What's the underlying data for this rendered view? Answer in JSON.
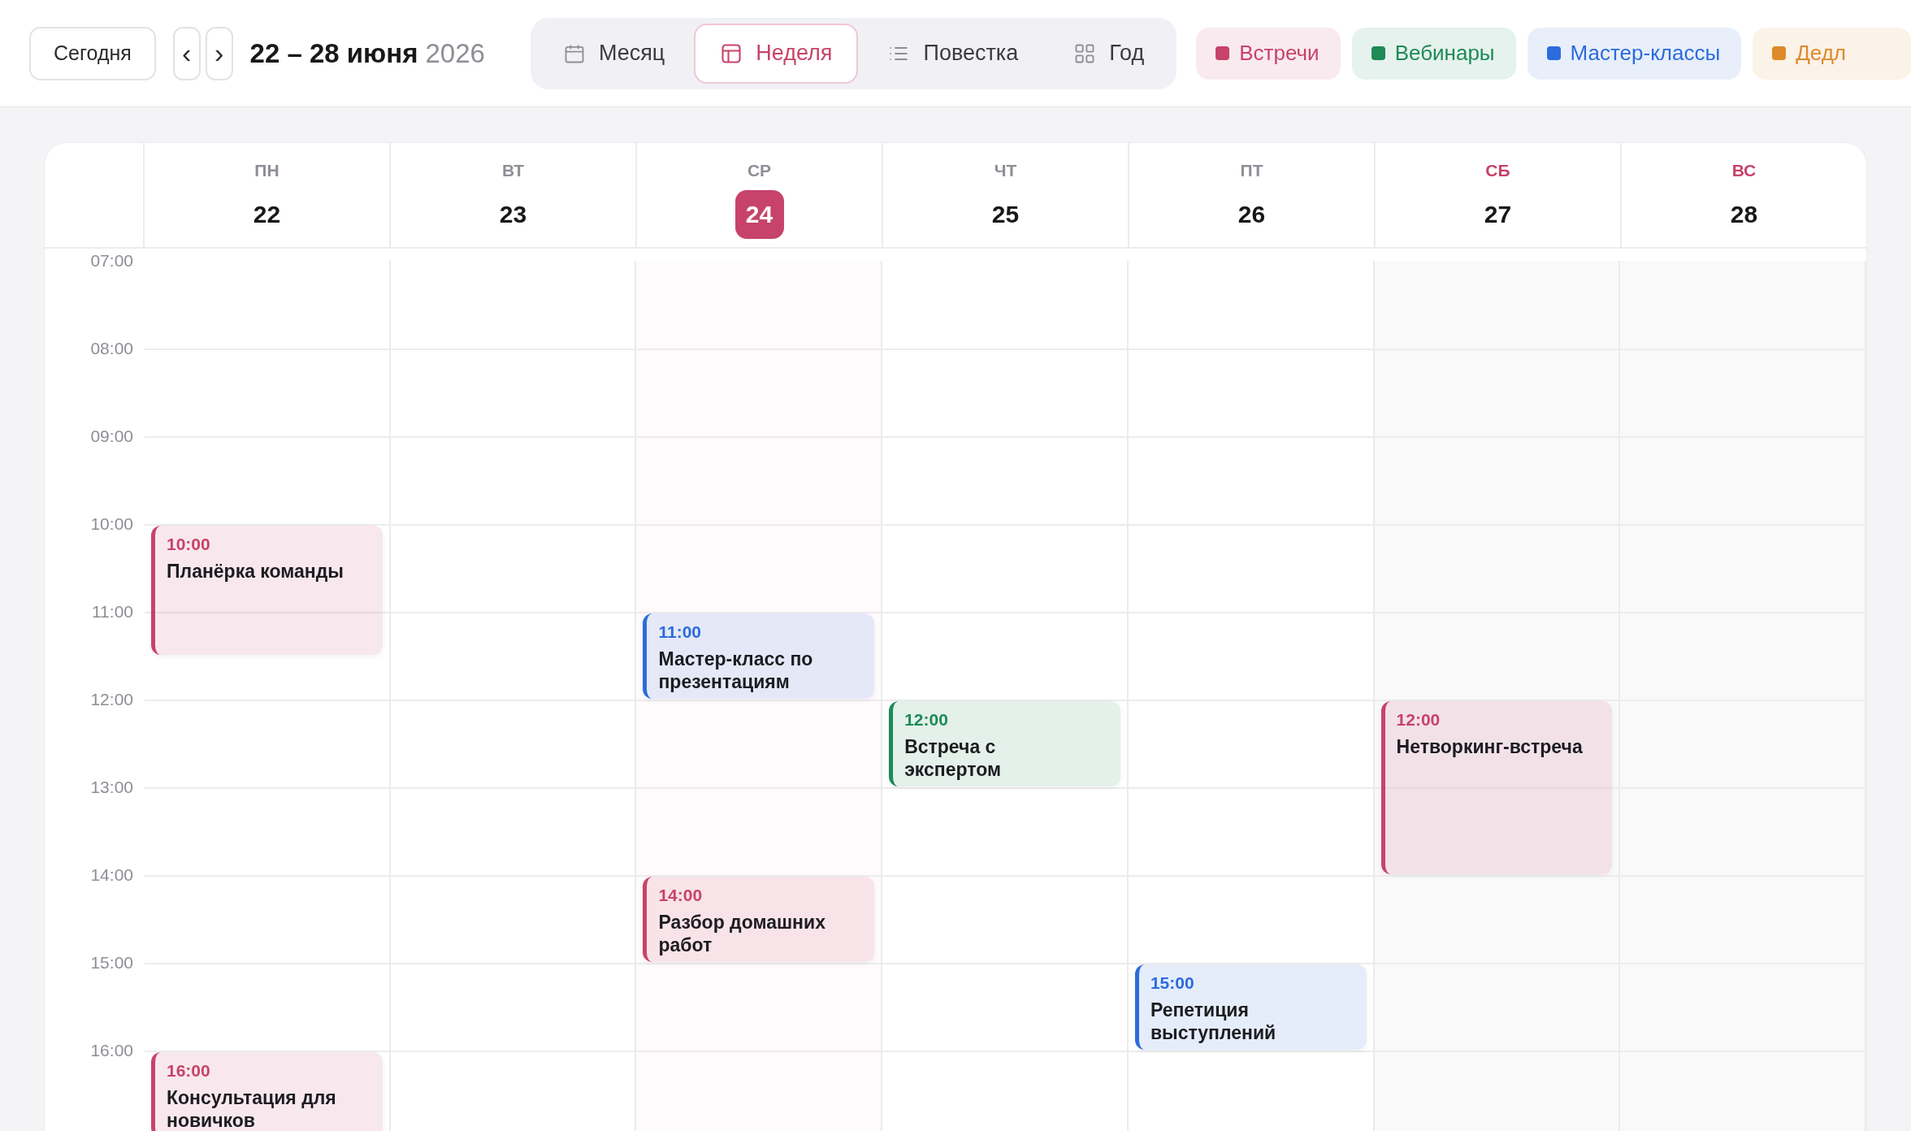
{
  "toolbar": {
    "today_button": "Сегодня",
    "prev_button": "‹",
    "next_button": "›",
    "range": "22 – 28 июня",
    "year": "2026"
  },
  "view_tabs": [
    {
      "label": "Месяц",
      "kind": "month",
      "selected": false
    },
    {
      "label": "Неделя",
      "kind": "week",
      "selected": true
    },
    {
      "label": "Повестка",
      "kind": "agenda",
      "selected": false
    },
    {
      "label": "Год",
      "kind": "year",
      "selected": false
    }
  ],
  "filters": [
    {
      "label": "Встречи",
      "color": "#c7436b"
    },
    {
      "label": "Вебинары",
      "color": "#1e8a57"
    },
    {
      "label": "Мастер-классы",
      "color": "#2c6bdc"
    },
    {
      "label": "Дедл",
      "color": "#dd8a2a"
    }
  ],
  "hours": [
    "07:00",
    "08:00",
    "09:00",
    "10:00",
    "11:00",
    "12:00",
    "13:00",
    "14:00",
    "15:00",
    "16:00"
  ],
  "days": [
    {
      "weekday": "ПН",
      "date": "22",
      "today": false,
      "weekend": false,
      "events": [
        {
          "time": "10:00",
          "title": "Планёрка команды",
          "kind": "medium",
          "color": "#c7436b"
        },
        {
          "time": "16:00",
          "title": "Консультация для новичков",
          "kind": "short",
          "color": "#c7436b"
        }
      ]
    },
    {
      "weekday": "ВТ",
      "date": "23",
      "today": false,
      "weekend": false
    },
    {
      "weekday": "СР",
      "date": "24",
      "today": true,
      "weekend": false,
      "events": [
        {
          "time": "11:00",
          "title": "Мастер-класс по презентациям",
          "kind": "short",
          "color": "#2c6bdc"
        },
        {
          "time": "14:00",
          "title": "Разбор домашних работ",
          "kind": "short",
          "color": "#c7436b"
        }
      ]
    },
    {
      "weekday": "ЧТ",
      "date": "25",
      "today": false,
      "weekend": false,
      "events": [
        {
          "time": "12:00",
          "title": "Встреча с экспертом",
          "kind": "short",
          "color": "#1e8a57"
        }
      ]
    },
    {
      "weekday": "ПТ",
      "date": "26",
      "today": false,
      "weekend": false,
      "events": [
        {
          "time": "15:00",
          "title": "Репетиция выступлений",
          "kind": "short",
          "color": "#2c6bdc"
        }
      ]
    },
    {
      "weekday": "СБ",
      "date": "27",
      "today": false,
      "weekend": true,
      "events": [
        {
          "time": "12:00",
          "title": "Нетворкинг-встреча",
          "kind": "long",
          "color": "#c7436b"
        }
      ]
    },
    {
      "weekday": "ВС",
      "date": "28",
      "today": false,
      "weekend": true
    }
  ]
}
